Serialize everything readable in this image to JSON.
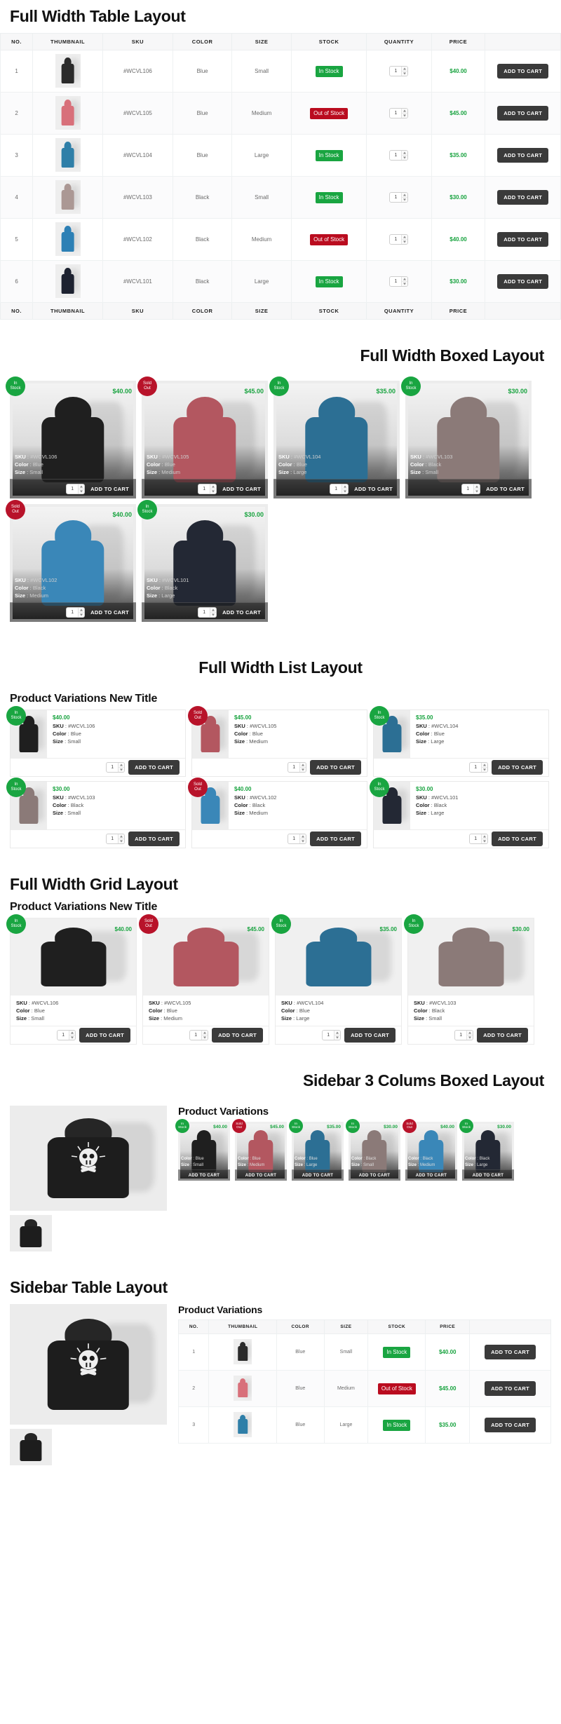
{
  "colors": {
    "in_stock": "#19a541",
    "out_of_stock": "#ba0c1f",
    "price": "#18a33f",
    "button": "#3a3a3a"
  },
  "labels": {
    "add_to_cart": "ADD TO CART",
    "in_stock": "In Stock",
    "out_of_stock": "Out of Stock",
    "sold_out_line1": "Sold",
    "sold_out_line2": "Out",
    "in_stock_line1": "In",
    "in_stock_line2": "Stock",
    "sku_label": "SKU",
    "color_label": "Color",
    "size_label": "Size",
    "qty_value": "1",
    "colon": " : "
  },
  "sections": {
    "table": {
      "title": "Full Width Table Layout"
    },
    "boxed": {
      "title": "Full Width Boxed Layout"
    },
    "list": {
      "title": "Full Width List Layout",
      "subtitle": "Product Variations New Title"
    },
    "grid": {
      "title": "Full Width Grid Layout",
      "subtitle": "Product Variations New Title"
    },
    "sidebar_boxed": {
      "title": "Sidebar 3 Colums Boxed  Layout",
      "subtitle": "Product Variations"
    },
    "sidebar_table": {
      "title": "Sidebar Table Layout",
      "subtitle": "Product Variations"
    }
  },
  "table": {
    "columns": [
      "NO.",
      "THUMBNAIL",
      "SKU",
      "COLOR",
      "SIZE",
      "STOCK",
      "QUANTITY",
      "PRICE",
      ""
    ],
    "rows": [
      {
        "no": "1",
        "sku": "#WCVL106",
        "color": "Blue",
        "size": "Small",
        "stock": "In Stock",
        "in_stock": true,
        "qty": "1",
        "price": "$40.00",
        "swatch": "#2b2b2b"
      },
      {
        "no": "2",
        "sku": "#WCVL105",
        "color": "Blue",
        "size": "Medium",
        "stock": "Out of Stock",
        "in_stock": false,
        "qty": "1",
        "price": "$45.00",
        "swatch": "#d8707a"
      },
      {
        "no": "3",
        "sku": "#WCVL104",
        "color": "Blue",
        "size": "Large",
        "stock": "In Stock",
        "in_stock": true,
        "qty": "1",
        "price": "$35.00",
        "swatch": "#2f7fa8"
      },
      {
        "no": "4",
        "sku": "#WCVL103",
        "color": "Black",
        "size": "Small",
        "stock": "In Stock",
        "in_stock": true,
        "qty": "1",
        "price": "$30.00",
        "swatch": "#ab9894"
      },
      {
        "no": "5",
        "sku": "#WCVL102",
        "color": "Black",
        "size": "Medium",
        "stock": "Out of Stock",
        "in_stock": false,
        "qty": "1",
        "price": "$40.00",
        "swatch": "#2d80b5"
      },
      {
        "no": "6",
        "sku": "#WCVL101",
        "color": "Black",
        "size": "Large",
        "stock": "In Stock",
        "in_stock": true,
        "qty": "1",
        "price": "$30.00",
        "swatch": "#1d2230"
      }
    ]
  },
  "products": [
    {
      "sku": "#WCVL106",
      "color": "Blue",
      "size": "Small",
      "price": "$40.00",
      "in_stock": true,
      "swatch": "#1f1f1f"
    },
    {
      "sku": "#WCVL105",
      "color": "Blue",
      "size": "Medium",
      "price": "$45.00",
      "in_stock": false,
      "swatch": "#b35760"
    },
    {
      "sku": "#WCVL104",
      "color": "Blue",
      "size": "Large",
      "price": "$35.00",
      "in_stock": true,
      "swatch": "#2c6f94"
    },
    {
      "sku": "#WCVL103",
      "color": "Black",
      "size": "Small",
      "price": "$30.00",
      "in_stock": true,
      "swatch": "#8b7a78"
    },
    {
      "sku": "#WCVL102",
      "color": "Black",
      "size": "Medium",
      "price": "$40.00",
      "in_stock": false,
      "swatch": "#3a87b8"
    },
    {
      "sku": "#WCVL101",
      "color": "Black",
      "size": "Large",
      "price": "$30.00",
      "in_stock": true,
      "swatch": "#232834"
    }
  ],
  "sidebar_table": {
    "columns": [
      "NO.",
      "THUMBNAIL",
      "COLOR",
      "SIZE",
      "STOCK",
      "PRICE",
      ""
    ],
    "rows": [
      {
        "no": "1",
        "color": "Blue",
        "size": "Small",
        "stock": "In Stock",
        "in_stock": true,
        "price": "$40.00",
        "swatch": "#2b2b2b"
      },
      {
        "no": "2",
        "color": "Blue",
        "size": "Medium",
        "stock": "Out of Stock",
        "in_stock": false,
        "price": "$45.00",
        "swatch": "#d8707a"
      },
      {
        "no": "3",
        "color": "Blue",
        "size": "Large",
        "stock": "In Stock",
        "in_stock": true,
        "price": "$35.00",
        "swatch": "#2f7fa8"
      }
    ]
  }
}
